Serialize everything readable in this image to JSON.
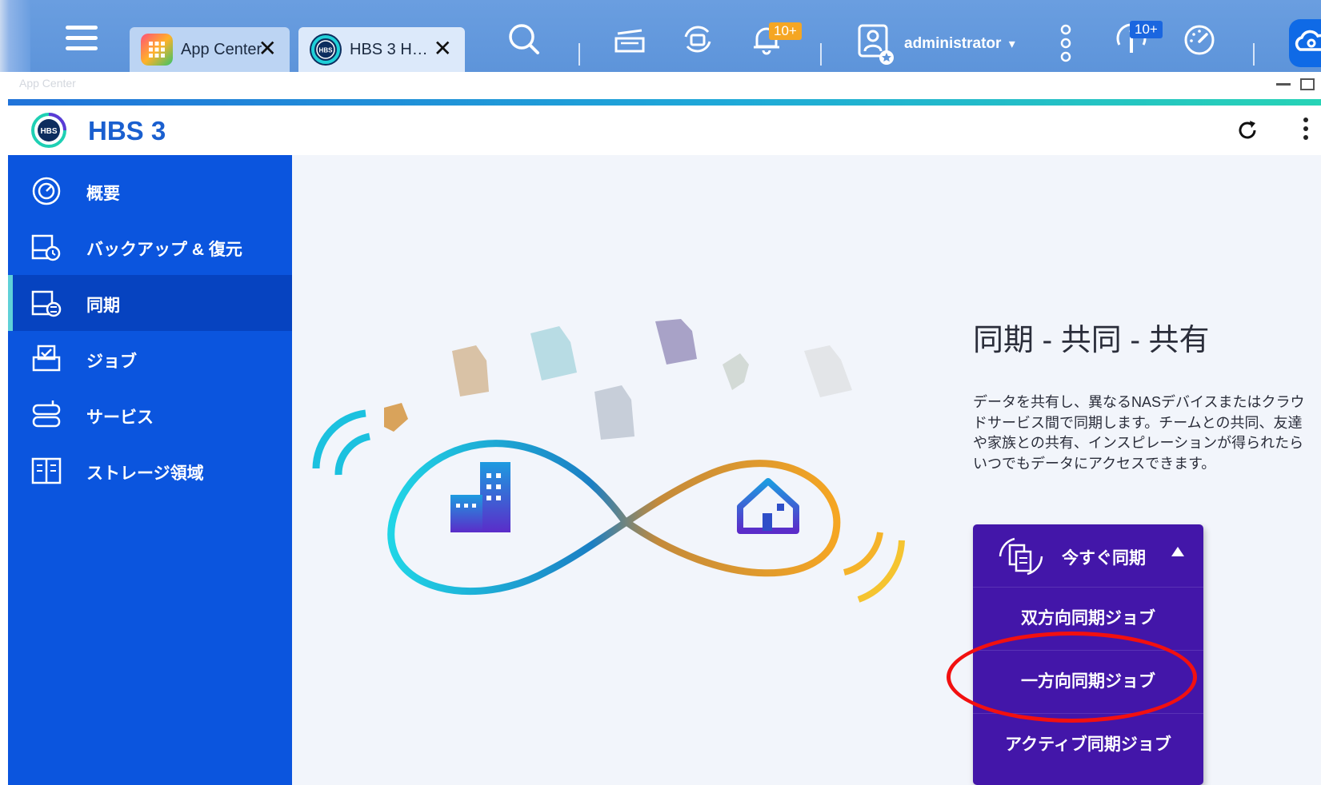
{
  "topbar": {
    "tabs": [
      {
        "label": "App Center",
        "icon": "app-center-icon"
      },
      {
        "label": "HBS 3 H…",
        "icon": "hbs3-icon"
      }
    ],
    "notification_badge": "10+",
    "info_badge": "10+",
    "username": "administrator",
    "username_caret": "▾"
  },
  "window": {
    "title": "App Center"
  },
  "app": {
    "title": "HBS 3",
    "logo_text": "HBS"
  },
  "sidebar": {
    "items": [
      {
        "label": "概要",
        "icon": "dashboard-icon"
      },
      {
        "label": "バックアップ & 復元",
        "icon": "backup-restore-icon"
      },
      {
        "label": "同期",
        "icon": "sync-icon"
      },
      {
        "label": "ジョブ",
        "icon": "jobs-icon"
      },
      {
        "label": "サービス",
        "icon": "services-icon"
      },
      {
        "label": "ストレージ領域",
        "icon": "storage-spaces-icon"
      }
    ],
    "active_index": 2
  },
  "main": {
    "heading": "同期 - 共同 - 共有",
    "description": "データを共有し、異なるNASデバイスまたはクラウドサービス間で同期します。チームとの共同、友達や家族との共有、インスピレーションが得られたらいつでもデータにアクセスできます。",
    "sync_menu": {
      "head_label": "今すぐ同期",
      "items": [
        "双方向同期ジョブ",
        "一方向同期ジョブ",
        "アクティブ同期ジョブ"
      ],
      "highlighted": "一方向同期ジョブ"
    }
  },
  "colors": {
    "topbar": "#6a9ee0",
    "sidebar": "#0b55de",
    "sidebar_active": "#0643c0",
    "sync_menu": "#4316a9",
    "highlight": "#f21010",
    "title_blue": "#1a5fcf"
  }
}
